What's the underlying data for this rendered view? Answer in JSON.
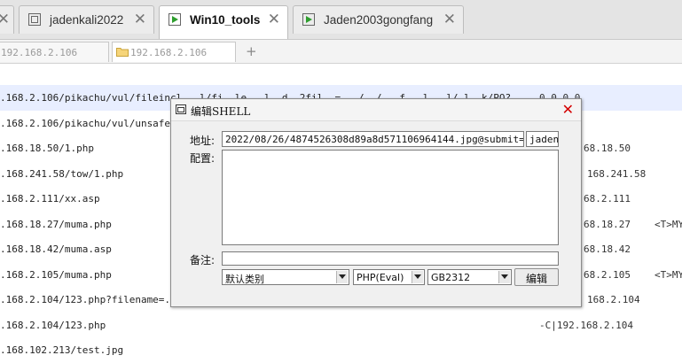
{
  "vm_tabs": [
    {
      "label": "jadenkali2022",
      "active": false
    },
    {
      "label": "Win10_tools",
      "active": true
    },
    {
      "label": "Jaden2003gongfang",
      "active": false
    }
  ],
  "vm_tab_close": "✕",
  "page_tabs": [
    {
      "label": "192.168.2.106"
    },
    {
      "label": "192.168.2.106"
    }
  ],
  "add_tab": "+",
  "rows": [
    {
      "url": ".168.2.106/pikachu/vul/fileincl...l/fi..le...l..d..2fil..= ../../...f...l...l/.l..k/PO?...",
      "ip": "",
      "extra": "0.0.0.0"
    },
    {
      "url": ".168.2.106/pikachu/vul/unsafeup...",
      "ip": "",
      "extra": ""
    },
    {
      "url": ".168.18.50/1.php",
      "ip": "68.18.50",
      "extra": ""
    },
    {
      "url": ".168.241.58/tow/1.php",
      "ip": "168.241.58",
      "extra": ""
    },
    {
      "url": ".168.2.111/xx.asp",
      "ip": "68.2.111",
      "extra": ""
    },
    {
      "url": ".168.18.27/muma.php",
      "ip": "68.18.27",
      "extra": "<T>MY"
    },
    {
      "url": ".168.18.42/muma.asp",
      "ip": "68.18.42",
      "extra": ""
    },
    {
      "url": ".168.2.105/muma.php",
      "ip": "68.2.105",
      "extra": "<T>MY"
    },
    {
      "url": ".168.2.104/123.php?filename=../...",
      "ip": "168.2.104",
      "extra": ""
    },
    {
      "url": ".168.2.104/123.php",
      "ip": "-C|192.168.2.104",
      "extra": ""
    },
    {
      "url": ".168.102.213/test.jpg",
      "ip": "",
      "extra": ""
    }
  ],
  "dialog": {
    "title": "编辑SHELL",
    "close": "✕",
    "address_label": "地址:",
    "address_value": "2022/08/26/4874526308d89a8d571106964144.jpg@submit=%E6%",
    "password_value": "jaden",
    "config_label": "配置:",
    "config_value": "",
    "note_label": "备注:",
    "note_value": "",
    "category_value": "默认类别",
    "type_value": "PHP(Eval)",
    "encoding_value": "GB2312",
    "edit_button": "编辑"
  },
  "colors": {
    "selected_row": "#e8eeff",
    "close_red": "#d40000"
  }
}
